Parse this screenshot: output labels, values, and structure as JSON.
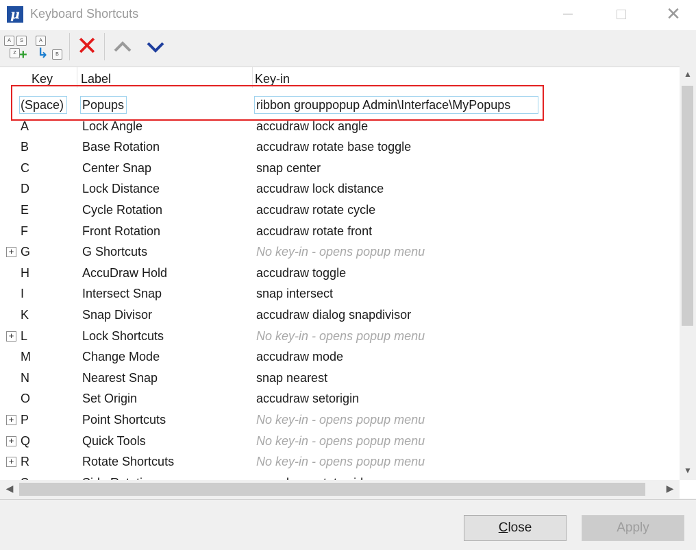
{
  "window": {
    "title": "Keyboard Shortcuts",
    "controls": {
      "minimize": "minimize",
      "maximize": "maximize",
      "close": "✕"
    }
  },
  "toolbar": {
    "add_icon_keys": [
      "A",
      "S",
      "Z"
    ],
    "link_icon_keys": [
      "A",
      "B"
    ]
  },
  "columns": {
    "key": "Key",
    "label": "Label",
    "keyin": "Key-in"
  },
  "rows": [
    {
      "key": "(Space)",
      "label": "Popups",
      "keyin": "ribbon grouppopup Admin\\Interface\\MyPopups",
      "expandable": false,
      "muted": false
    },
    {
      "key": "A",
      "label": "Lock Angle",
      "keyin": "accudraw lock angle",
      "expandable": false,
      "muted": false
    },
    {
      "key": "B",
      "label": "Base Rotation",
      "keyin": "accudraw rotate base toggle",
      "expandable": false,
      "muted": false
    },
    {
      "key": "C",
      "label": "Center Snap",
      "keyin": "snap center",
      "expandable": false,
      "muted": false
    },
    {
      "key": "D",
      "label": "Lock Distance",
      "keyin": "accudraw lock distance",
      "expandable": false,
      "muted": false
    },
    {
      "key": "E",
      "label": "Cycle Rotation",
      "keyin": "accudraw rotate cycle",
      "expandable": false,
      "muted": false
    },
    {
      "key": "F",
      "label": "Front Rotation",
      "keyin": "accudraw rotate front",
      "expandable": false,
      "muted": false
    },
    {
      "key": "G",
      "label": "G Shortcuts",
      "keyin": "No key-in - opens popup menu",
      "expandable": true,
      "muted": true
    },
    {
      "key": "H",
      "label": "AccuDraw Hold",
      "keyin": "accudraw toggle",
      "expandable": false,
      "muted": false
    },
    {
      "key": "I",
      "label": "Intersect Snap",
      "keyin": "snap intersect",
      "expandable": false,
      "muted": false
    },
    {
      "key": "K",
      "label": "Snap Divisor",
      "keyin": "accudraw dialog snapdivisor",
      "expandable": false,
      "muted": false
    },
    {
      "key": "L",
      "label": "Lock Shortcuts",
      "keyin": "No key-in - opens popup menu",
      "expandable": true,
      "muted": true
    },
    {
      "key": "M",
      "label": "Change Mode",
      "keyin": "accudraw mode",
      "expandable": false,
      "muted": false
    },
    {
      "key": "N",
      "label": "Nearest Snap",
      "keyin": "snap nearest",
      "expandable": false,
      "muted": false
    },
    {
      "key": "O",
      "label": "Set Origin",
      "keyin": "accudraw setorigin",
      "expandable": false,
      "muted": false
    },
    {
      "key": "P",
      "label": "Point Shortcuts",
      "keyin": "No key-in - opens popup menu",
      "expandable": true,
      "muted": true
    },
    {
      "key": "Q",
      "label": "Quick Tools",
      "keyin": "No key-in - opens popup menu",
      "expandable": true,
      "muted": true
    },
    {
      "key": "R",
      "label": "Rotate Shortcuts",
      "keyin": "No key-in - opens popup menu",
      "expandable": true,
      "muted": true
    },
    {
      "key": "S",
      "label": "Side Rotation",
      "keyin": "accudraw rotate side",
      "expandable": false,
      "muted": false
    }
  ],
  "footer": {
    "close_label": "Close",
    "close_mnemonic": "C",
    "close_rest": "lose",
    "apply_label": "Apply"
  },
  "colors": {
    "highlight_border": "#e32222",
    "muted_text": "#a8a8a8",
    "delete_red": "#e31b1b",
    "chevron_blue": "#1f3f9e"
  }
}
